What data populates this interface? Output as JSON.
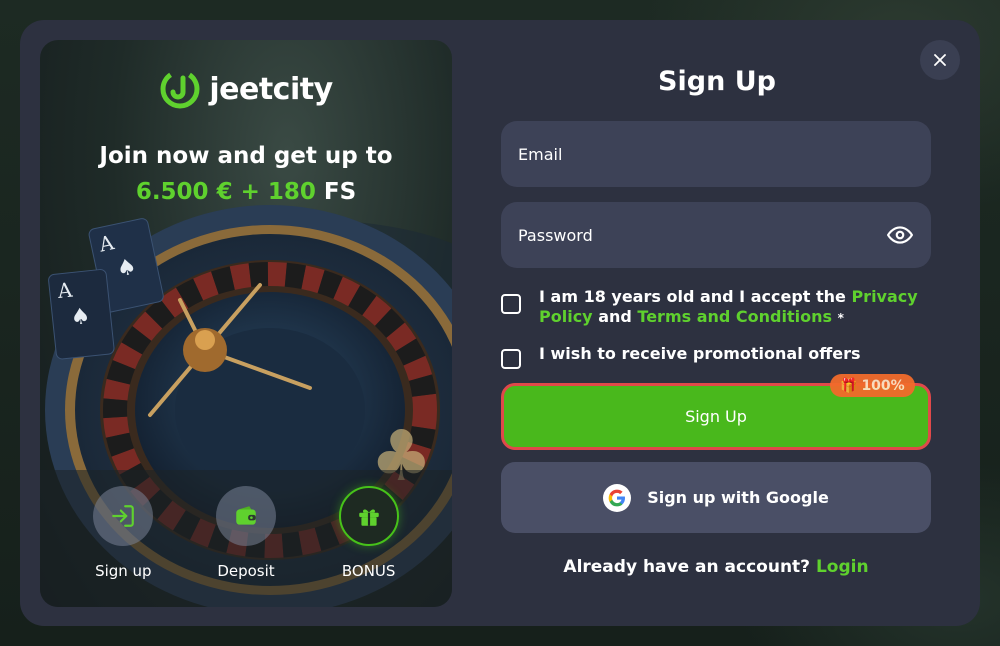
{
  "brand": {
    "name": "jeetcity",
    "accent": "#5fd12e"
  },
  "promo": {
    "headline_line1": "Join now and get up to",
    "bonus_amount": "6.500 € + 180",
    "bonus_suffix": "FS",
    "actions": [
      {
        "label": "Sign up",
        "icon": "login-icon"
      },
      {
        "label": "Deposit",
        "icon": "wallet-icon"
      },
      {
        "label": "BONUS",
        "icon": "gift-icon"
      }
    ]
  },
  "form": {
    "title": "Sign Up",
    "email_placeholder": "Email",
    "password_placeholder": "Password",
    "terms": {
      "prefix": "I am 18 years old and I accept the",
      "privacy_link": "Privacy Policy",
      "and": "and",
      "terms_link": "Terms and Conditions",
      "required_mark": "*"
    },
    "promo_offers_label": "I wish to receive promotional offers",
    "signup_button": "Sign Up",
    "badge": "100%",
    "google_button": "Sign up with Google",
    "have_account": "Already have an account?",
    "login_link": "Login"
  },
  "colors": {
    "modal_bg": "#2d3140",
    "field_bg": "#3d4257",
    "signup_green": "#49b81c",
    "signup_border": "#e0494a",
    "badge_orange": "#f26b2b"
  }
}
